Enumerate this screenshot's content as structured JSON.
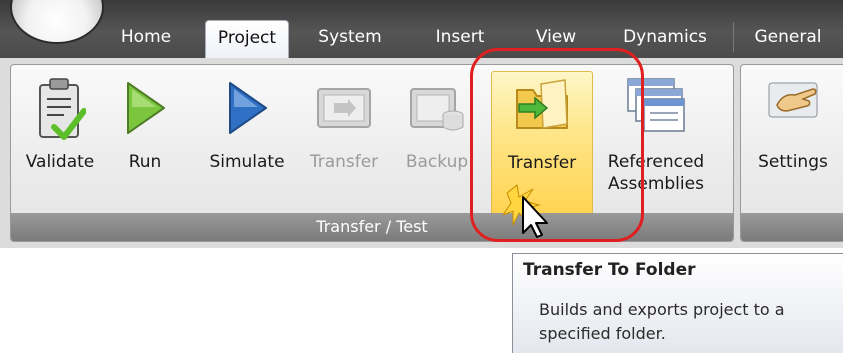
{
  "tabs": [
    {
      "label": "Home"
    },
    {
      "label": "Project"
    },
    {
      "label": "System"
    },
    {
      "label": "Insert"
    },
    {
      "label": "View"
    },
    {
      "label": "Dynamics"
    },
    {
      "label": "General"
    }
  ],
  "active_tab": "Project",
  "ribbon": {
    "group_label": "Transfer / Test",
    "buttons": [
      {
        "label": "Validate",
        "icon": "clipboard-check-icon",
        "enabled": true
      },
      {
        "label": "Run",
        "icon": "play-green-icon",
        "enabled": true
      },
      {
        "label": "Simulate",
        "icon": "play-blue-icon",
        "enabled": true
      },
      {
        "label": "Transfer",
        "icon": "transfer-device-icon",
        "enabled": false
      },
      {
        "label": "Backup",
        "icon": "backup-icon",
        "enabled": false
      },
      {
        "label": "Transfer",
        "icon": "folder-transfer-icon",
        "enabled": true,
        "hovered": true
      },
      {
        "label": "Referenced Assemblies",
        "icon": "stacked-windows-icon",
        "enabled": true
      }
    ],
    "settings": {
      "label": "Settings",
      "icon": "hand-pointer-icon"
    }
  },
  "tooltip": {
    "title": "Transfer To Folder",
    "body": "Builds and exports project to a specified folder."
  },
  "colors": {
    "tabbar": "#4a4a4a",
    "highlight_ring": "#e02020",
    "hover_button": "#ffd24d",
    "group_label_bg": "#8a8a8a"
  }
}
